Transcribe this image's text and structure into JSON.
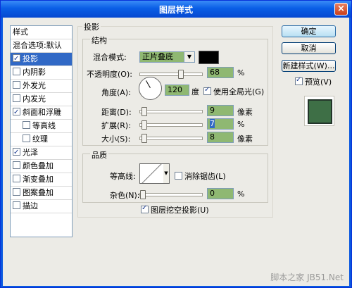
{
  "window": {
    "title": "图层样式",
    "close_glyph": "×"
  },
  "sidebar": {
    "header": "样式",
    "items": [
      {
        "label": "混合选项:默认",
        "checkbox": false,
        "checked": false,
        "selected": false,
        "indent": 0
      },
      {
        "label": "投影",
        "checkbox": true,
        "checked": true,
        "selected": true,
        "indent": 0
      },
      {
        "label": "内阴影",
        "checkbox": true,
        "checked": false,
        "selected": false,
        "indent": 0
      },
      {
        "label": "外发光",
        "checkbox": true,
        "checked": false,
        "selected": false,
        "indent": 0
      },
      {
        "label": "内发光",
        "checkbox": true,
        "checked": false,
        "selected": false,
        "indent": 0
      },
      {
        "label": "斜面和浮雕",
        "checkbox": true,
        "checked": true,
        "selected": false,
        "indent": 0
      },
      {
        "label": "等高线",
        "checkbox": true,
        "checked": false,
        "selected": false,
        "indent": 1
      },
      {
        "label": "纹理",
        "checkbox": true,
        "checked": false,
        "selected": false,
        "indent": 1
      },
      {
        "label": "光泽",
        "checkbox": true,
        "checked": true,
        "selected": false,
        "indent": 0
      },
      {
        "label": "颜色叠加",
        "checkbox": true,
        "checked": false,
        "selected": false,
        "indent": 0
      },
      {
        "label": "渐变叠加",
        "checkbox": true,
        "checked": false,
        "selected": false,
        "indent": 0
      },
      {
        "label": "图案叠加",
        "checkbox": true,
        "checked": false,
        "selected": false,
        "indent": 0
      },
      {
        "label": "描边",
        "checkbox": true,
        "checked": false,
        "selected": false,
        "indent": 0
      }
    ]
  },
  "panel": {
    "title": "投影",
    "structure": {
      "title": "结构",
      "blend_mode_label": "混合模式:",
      "blend_mode_value": "正片叠底",
      "shadow_color": "#000000",
      "opacity_label": "不透明度(O):",
      "opacity_value": "68",
      "opacity_unit": "%",
      "opacity_level": 0.68,
      "angle_label": "角度(A):",
      "angle_value": "120",
      "angle_unit": "度",
      "global_light_label": "使用全局光(G)",
      "global_light_checked": true,
      "distance_label": "距离(D):",
      "distance_value": "9",
      "distance_unit": "像素",
      "spread_label": "扩展(R):",
      "spread_value": "7",
      "spread_unit": "%",
      "size_label": "大小(S):",
      "size_value": "8",
      "size_unit": "像素"
    },
    "quality": {
      "title": "品质",
      "contour_label": "等高线:",
      "anti_alias_label": "消除锯齿(L)",
      "anti_alias_checked": false,
      "noise_label": "杂色(N):",
      "noise_value": "0",
      "noise_unit": "%"
    },
    "knockout_label": "图层挖空投影(U)",
    "knockout_checked": true
  },
  "buttons": {
    "ok": "确定",
    "cancel": "取消",
    "new_style": "新建样式(W)..."
  },
  "preview": {
    "label": "预览(V)",
    "checked": true,
    "swatch_color": "#3e6f46"
  },
  "watermark": "脚本之家 JB51.Net"
}
